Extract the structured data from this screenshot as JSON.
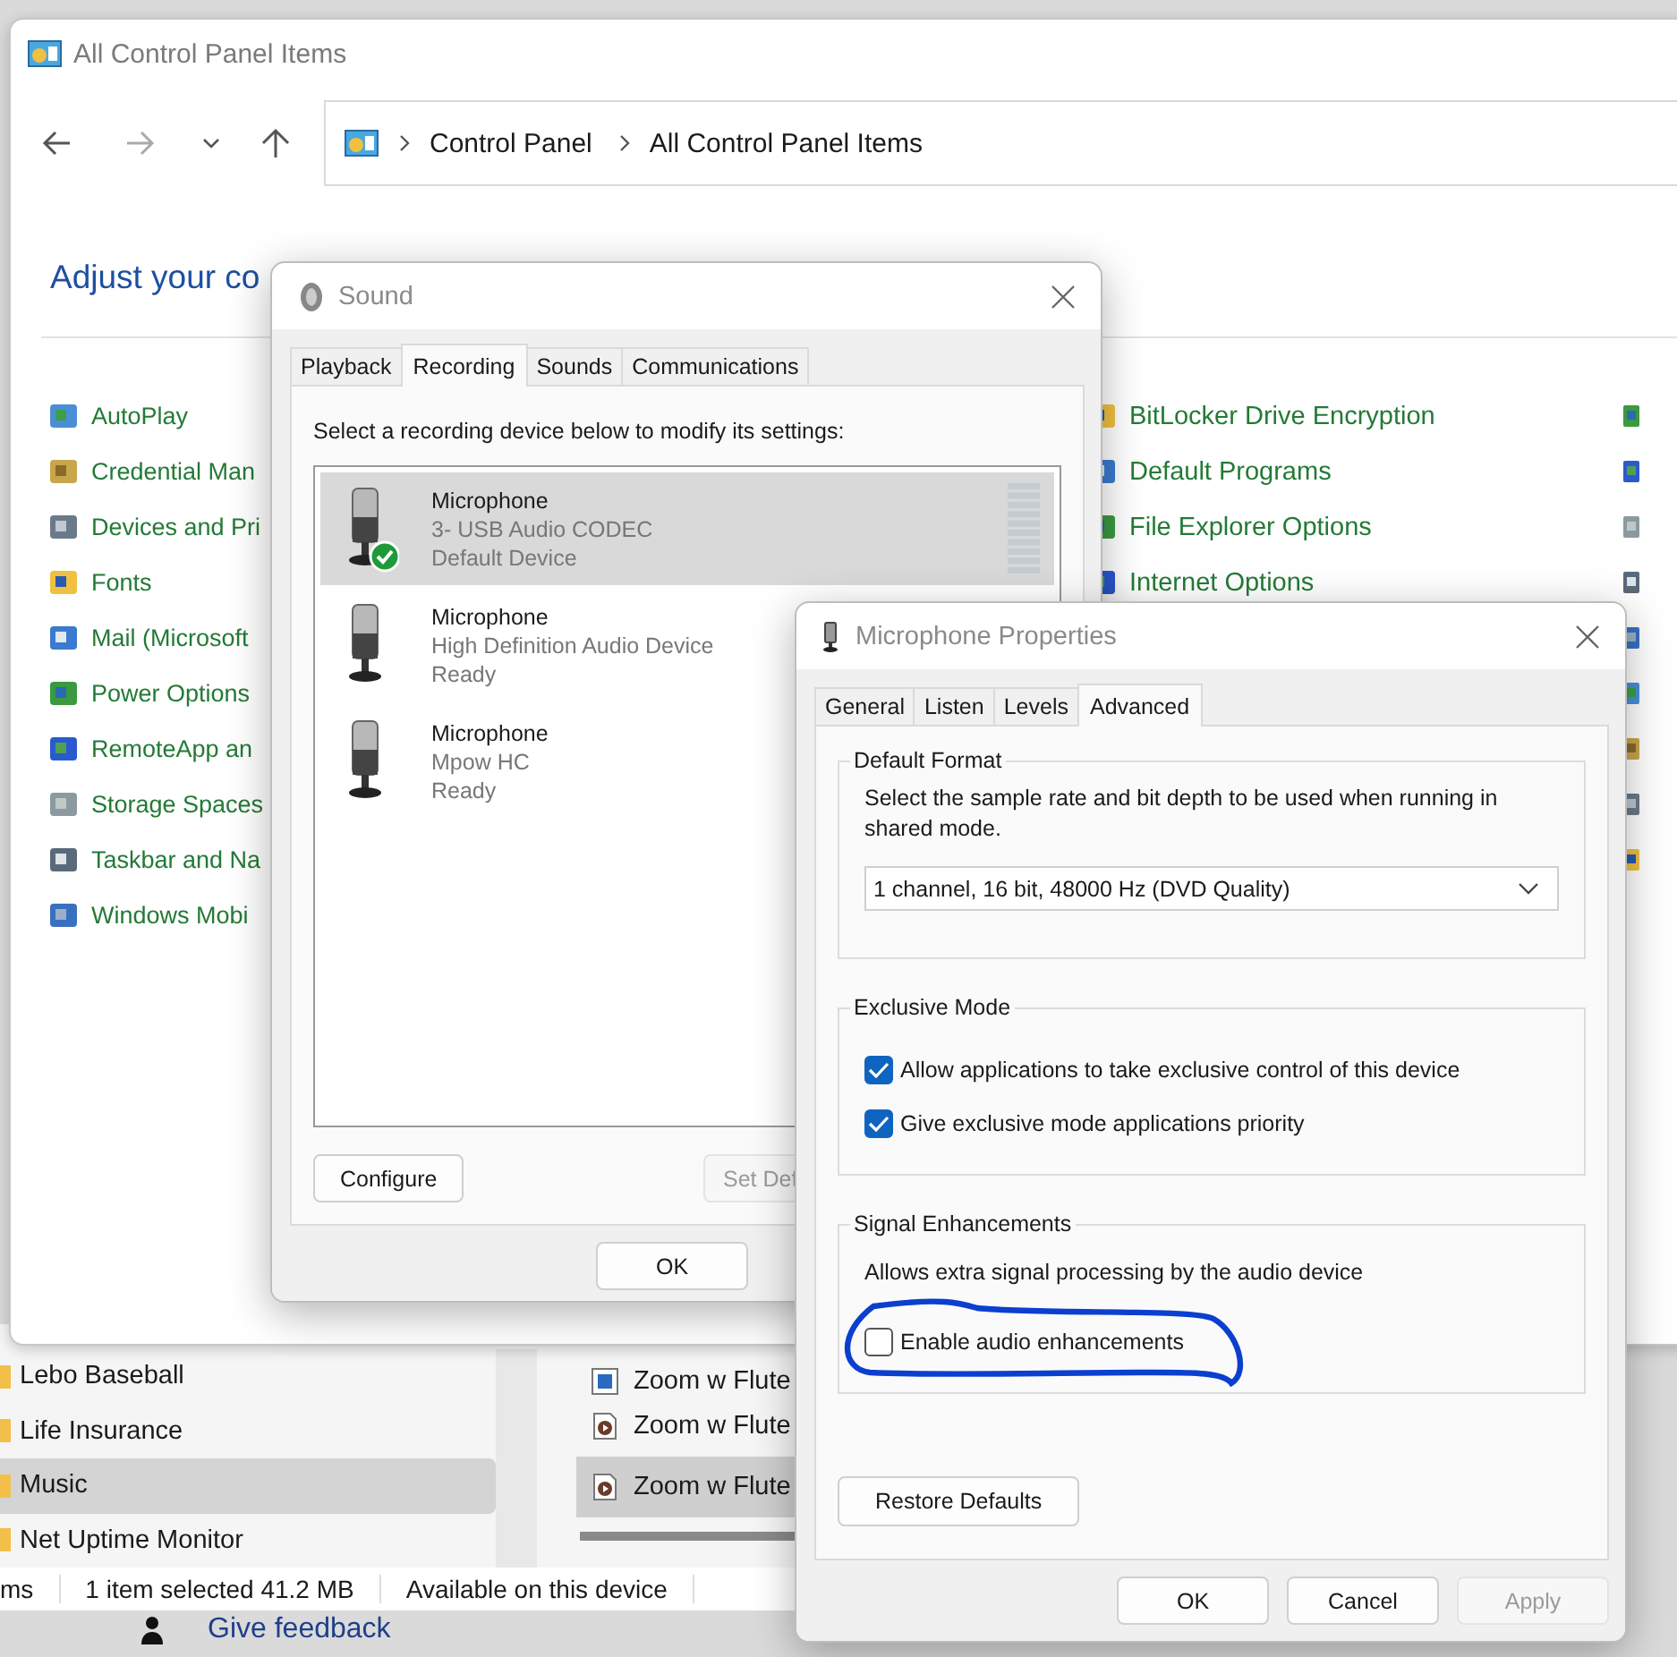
{
  "explorer": {
    "folders": [
      {
        "label": "Lebo Baseball",
        "selected": false
      },
      {
        "label": "Life Insurance",
        "selected": false
      },
      {
        "label": "Music",
        "selected": true
      },
      {
        "label": "Net Uptime Monitor",
        "selected": false
      }
    ],
    "files": [
      {
        "label": "Zoom w Flute",
        "kind": "image",
        "selected": false
      },
      {
        "label": "Zoom w Flute",
        "kind": "audio",
        "selected": false
      },
      {
        "label": "Zoom w Flute",
        "kind": "audio",
        "selected": true
      }
    ],
    "status_bar": [
      "ms",
      "1 item selected  41.2 MB",
      "Available on this device"
    ],
    "feedback": "Give feedback"
  },
  "control_panel": {
    "title": "All Control Panel Items",
    "breadcrumb": [
      "Control Panel",
      "All Control Panel Items"
    ],
    "heading": "Adjust your co",
    "column_1": [
      "AutoPlay",
      "Credential Man",
      "Devices and Pri",
      "Fonts",
      "Mail (Microsoft",
      "Power Options",
      "RemoteApp an",
      "Storage Spaces",
      "Taskbar and Na",
      "Windows Mobi"
    ],
    "column_3": [
      "BitLocker Drive Encryption",
      "Default Programs",
      "File Explorer Options",
      "Internet Options"
    ]
  },
  "sound": {
    "title": "Sound",
    "tabs": [
      {
        "label": "Playback",
        "selected": false
      },
      {
        "label": "Recording",
        "selected": true
      },
      {
        "label": "Sounds",
        "selected": false
      },
      {
        "label": "Communications",
        "selected": false
      }
    ],
    "instruction": "Select a recording device below to modify its settings:",
    "devices": [
      {
        "name": "Microphone",
        "description": "3- USB Audio CODEC",
        "status": "Default Device",
        "default": true,
        "selected": true
      },
      {
        "name": "Microphone",
        "description": "High Definition Audio Device",
        "status": "Ready",
        "default": false,
        "selected": false
      },
      {
        "name": "Microphone",
        "description": "Mpow HC",
        "status": "Ready",
        "default": false,
        "selected": false
      }
    ],
    "buttons": [
      {
        "label": "Configure",
        "disabled": false
      },
      {
        "label": "Set Def",
        "disabled": true
      }
    ],
    "footer": [
      {
        "label": "OK",
        "disabled": false
      }
    ]
  },
  "mic_properties": {
    "title": "Microphone Properties",
    "tabs": [
      {
        "label": "General",
        "selected": false
      },
      {
        "label": "Listen",
        "selected": false
      },
      {
        "label": "Levels",
        "selected": false
      },
      {
        "label": "Advanced",
        "selected": true
      }
    ],
    "default_format": {
      "title": "Default Format",
      "description": "Select the sample rate and bit depth to be used when running in shared mode.",
      "value": "1 channel, 16 bit, 48000 Hz (DVD Quality)"
    },
    "exclusive_mode": {
      "title": "Exclusive Mode",
      "options": [
        {
          "label": "Allow applications to take exclusive control of this device",
          "checked": true
        },
        {
          "label": "Give exclusive mode applications priority",
          "checked": true
        }
      ]
    },
    "signal_enhancements": {
      "title": "Signal Enhancements",
      "description": "Allows extra signal processing by the audio device",
      "options": [
        {
          "label": "Enable audio enhancements",
          "checked": false
        }
      ]
    },
    "restore_button": "Restore Defaults",
    "footer": [
      {
        "label": "OK",
        "disabled": false
      },
      {
        "label": "Cancel",
        "disabled": false
      },
      {
        "label": "Apply",
        "disabled": true
      }
    ]
  }
}
